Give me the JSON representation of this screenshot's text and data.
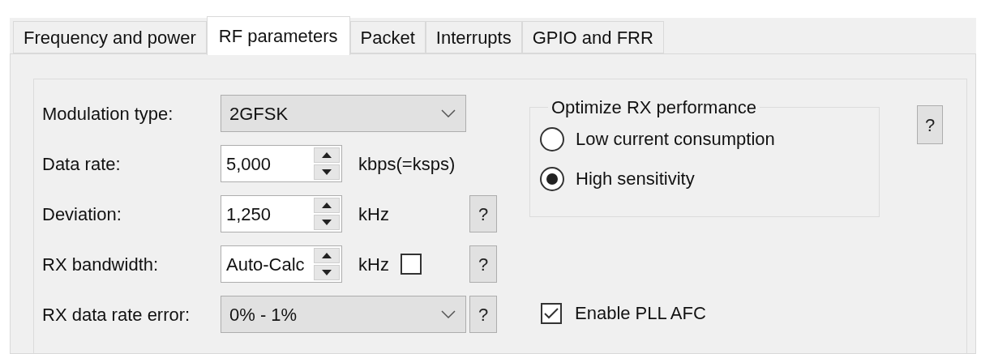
{
  "tabs": [
    {
      "label": "Frequency and power",
      "selected": false
    },
    {
      "label": "RF parameters",
      "selected": true
    },
    {
      "label": "Packet",
      "selected": false
    },
    {
      "label": "Interrupts",
      "selected": false
    },
    {
      "label": "GPIO and FRR",
      "selected": false
    }
  ],
  "fields": [
    {
      "kind": "combo",
      "label": "Modulation type:",
      "value": "2GFSK"
    },
    {
      "kind": "spin",
      "label": "Data rate:",
      "value": "5,000",
      "unit": "kbps(=ksps)"
    },
    {
      "kind": "spin",
      "label": "Deviation:",
      "value": "1,250",
      "unit": "kHz",
      "help": "?"
    },
    {
      "kind": "spin",
      "label": "RX bandwidth:",
      "value": "Auto-Calc",
      "unit": "kHz",
      "checkbox": {
        "checked": false
      },
      "help": "?"
    },
    {
      "kind": "combo",
      "label": "RX data rate error:",
      "value": "0% - 1%",
      "help": "?"
    }
  ],
  "rx_performance": {
    "title": "Optimize RX performance",
    "options": [
      {
        "label": "Low current consumption",
        "selected": false
      },
      {
        "label": "High sensitivity",
        "selected": true
      }
    ],
    "help": "?"
  },
  "pll_afc": {
    "label": "Enable PLL AFC",
    "checked": true
  }
}
